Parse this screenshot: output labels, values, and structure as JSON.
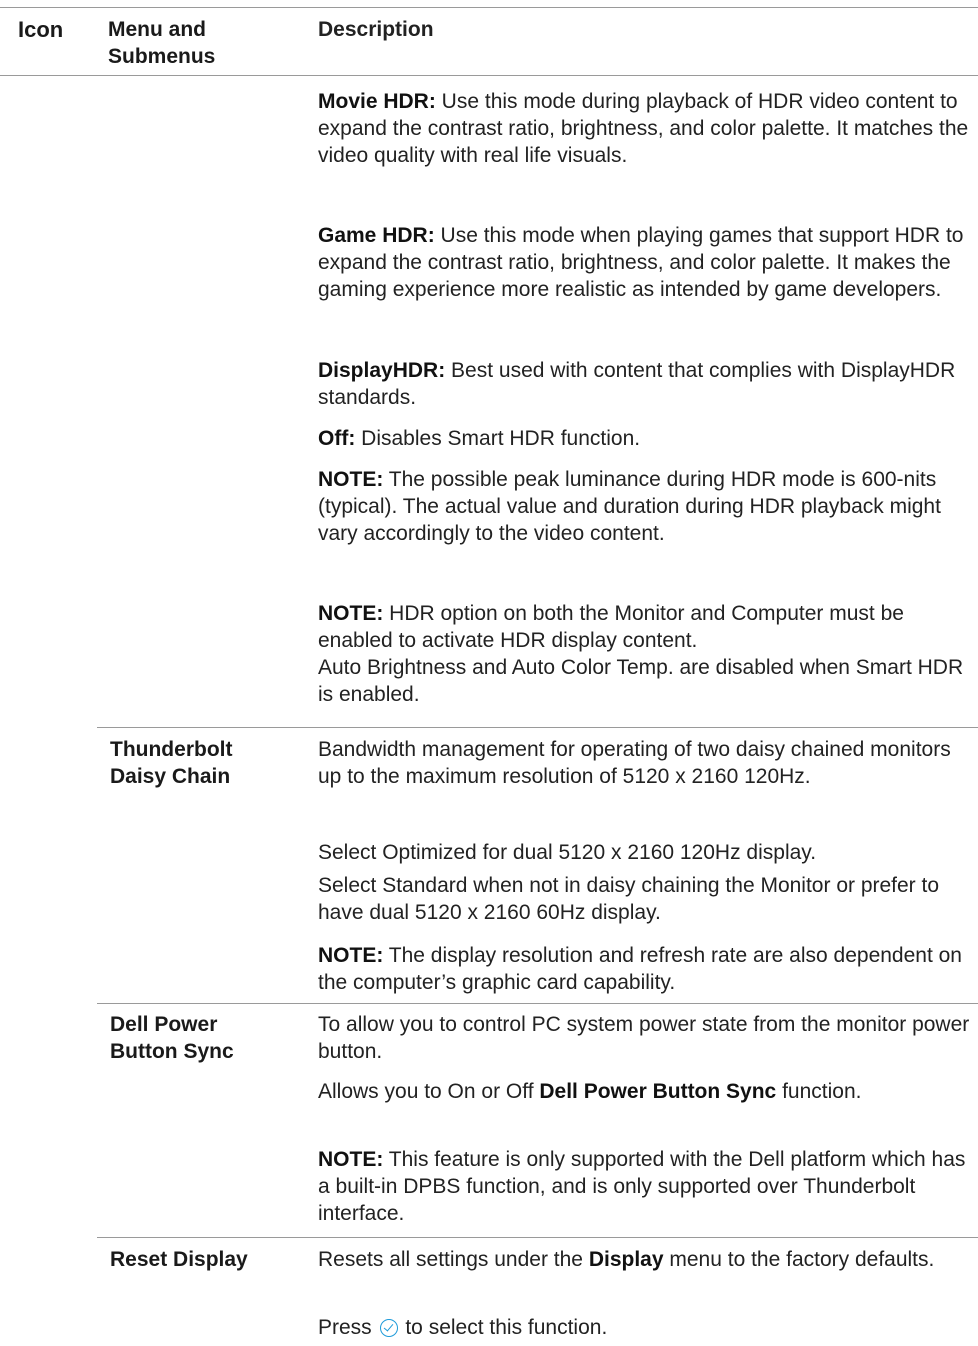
{
  "header": {
    "icon_col": "Icon",
    "menu_col_line1": "Menu and",
    "menu_col_line2": "Submenus",
    "desc_col": "Description"
  },
  "smart_hdr": {
    "movie_hdr_label": "Movie HDR:",
    "movie_hdr_text": " Use this mode during playback of HDR video content to expand the contrast ratio, brightness, and color palette. It matches the video quality with real life visuals.",
    "game_hdr_label": "Game HDR:",
    "game_hdr_text": " Use this mode when playing games that support HDR to expand the contrast ratio, brightness, and color palette. It makes the gaming experience more realistic as intended by game developers.",
    "displayhdr_label": "DisplayHDR:",
    "displayhdr_text": " Best used with content that complies with DisplayHDR standards.",
    "off_label": "Off:",
    "off_text": " Disables Smart HDR function.",
    "note1_label": "NOTE:",
    "note1_text": " The possible peak luminance during HDR mode is 600-nits (typical). The actual value and duration during HDR playback might vary accordingly to the video content.",
    "note2_label": "NOTE:",
    "note2_text": " HDR option on both the Monitor and Computer must be enabled to activate HDR display content.",
    "note2_extra": "Auto Brightness and Auto Color Temp. are disabled when Smart HDR is enabled."
  },
  "thunderbolt": {
    "menu_line1": "Thunderbolt",
    "menu_line2": "Daisy Chain",
    "p1": "Bandwidth management for operating of two daisy chained monitors up to the maximum resolution of 5120 x 2160 120Hz.",
    "p2": "Select Optimized for dual 5120 x 2160 120Hz display.",
    "p3": "Select Standard when not in daisy chaining the Monitor or prefer to have dual 5120 x 2160 60Hz display.",
    "note_label": "NOTE:",
    "note_text": " The display resolution and refresh rate are also dependent on the computer’s graphic card capability."
  },
  "power_sync": {
    "menu_line1": "Dell Power",
    "menu_line2": "Button Sync",
    "p1": "To allow you to control PC system power state from the monitor power button.",
    "p2_pre": "Allows you to On or Off ",
    "p2_bold": "Dell Power Button Sync",
    "p2_post": " function.",
    "note_label": "NOTE:",
    "note_text": " This feature is only supported with the Dell platform which has a built-in DPBS function, and is only supported over Thunderbolt interface."
  },
  "reset_display": {
    "menu_label": "Reset Display",
    "p1_pre": "Resets all settings under the ",
    "p1_bold": "Display",
    "p1_post": " menu to the factory defaults.",
    "p2_pre": "Press ",
    "p2_icon": "check-circle-icon",
    "p2_post": " to select this function."
  }
}
